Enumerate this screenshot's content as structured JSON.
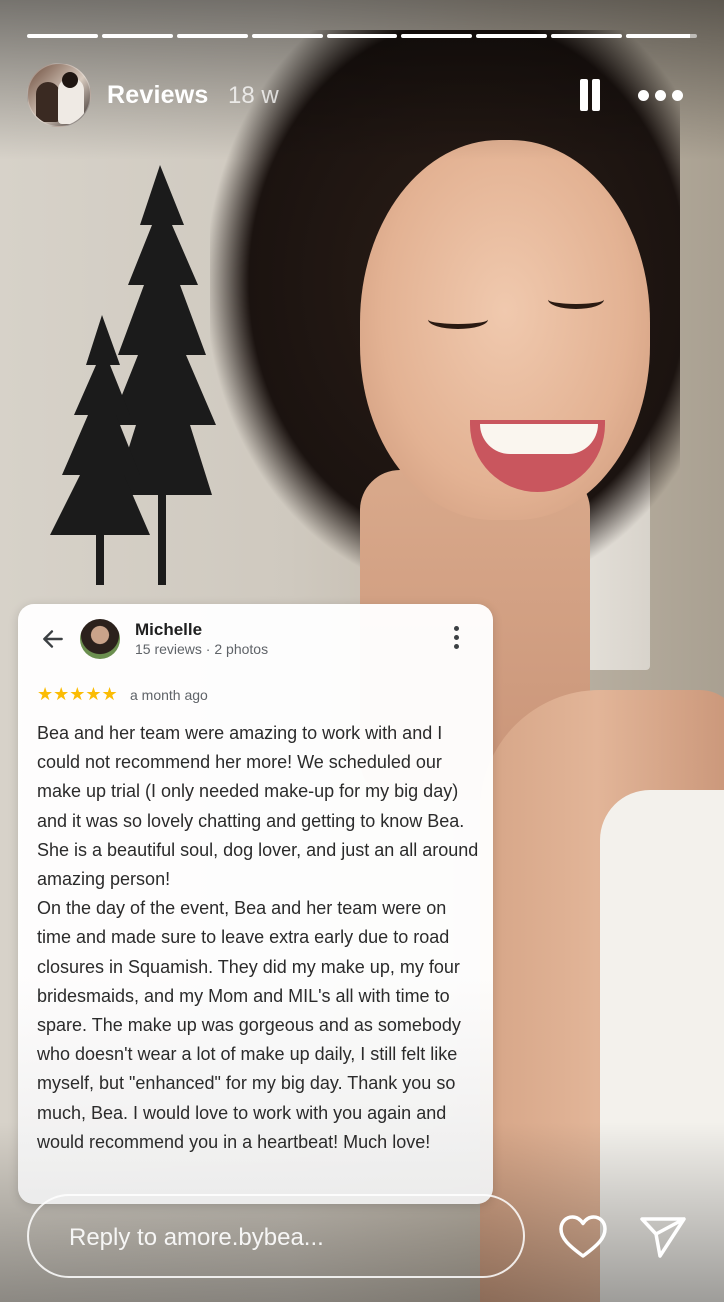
{
  "story": {
    "segments": [
      {
        "progress": 1.0
      },
      {
        "progress": 1.0
      },
      {
        "progress": 1.0
      },
      {
        "progress": 1.0
      },
      {
        "progress": 1.0
      },
      {
        "progress": 1.0
      },
      {
        "progress": 1.0
      },
      {
        "progress": 1.0
      },
      {
        "progress": 0.9
      }
    ],
    "header": {
      "username": "Reviews",
      "time_ago": "18 w",
      "pause_icon": "pause-icon",
      "more_icon": "more-horizontal-icon"
    }
  },
  "review": {
    "back_icon": "arrow-left-icon",
    "reviewer_name": "Michelle",
    "reviewer_meta": "15 reviews · 2 photos",
    "rating": 5,
    "stars": "★★★★★",
    "date": "a month ago",
    "paragraphs": [
      "Bea and her team were amazing to work with and I could not recommend her more! We scheduled our make up trial (I only needed make-up for my big day) and it was so lovely chatting and getting to know Bea. She is a beautiful soul, dog lover, and just an all around amazing person!",
      "On the day of the event, Bea and her team were on time and made sure to leave extra early due to road closures in Squamish. They did my make up, my four bridesmaids, and my Mom and MIL's all with time to spare. The make up was gorgeous and as somebody who doesn't wear a lot of make up daily, I still felt like myself, but \"enhanced\" for my big day. Thank you so much, Bea. I would love to work with you again and would recommend you in a heartbeat! Much love!"
    ],
    "accent_color": "#fbbc04"
  },
  "footer": {
    "reply_placeholder": "Reply to amore.bybea...",
    "like_icon": "heart-outline-icon",
    "share_icon": "send-icon"
  }
}
